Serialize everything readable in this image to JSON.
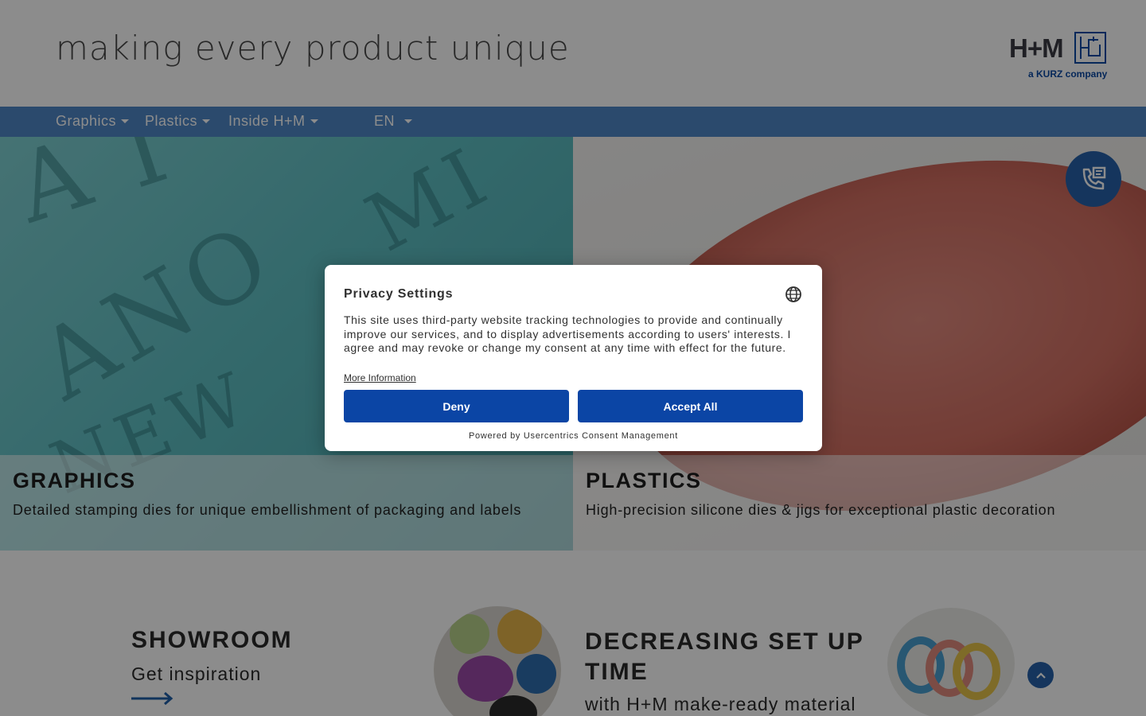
{
  "header": {
    "tagline": "making every product unique",
    "logo_text": "H+M",
    "logo_sub": "a KURZ company"
  },
  "nav": {
    "items": [
      {
        "label": "Graphics"
      },
      {
        "label": "Plastics"
      },
      {
        "label": "Inside H+M"
      }
    ],
    "language": "EN"
  },
  "tiles": {
    "graphics": {
      "title": "GRAPHICS",
      "description": "Detailed stamping dies for unique embellishment of packaging and labels"
    },
    "plastics": {
      "title": "PLASTICS",
      "description": "High-precision silicone dies & jigs for exceptional plastic decoration"
    }
  },
  "features": {
    "showroom": {
      "title": "SHOWROOM",
      "subtitle": "Get inspiration"
    },
    "setup": {
      "title": "DECREASING SET UP TIME",
      "subtitle": "with H+M make-ready material"
    }
  },
  "consent": {
    "title": "Privacy Settings",
    "body": "This site uses third-party website tracking technologies to provide and continually improve our services, and to display advertisements according to users' interests. I agree and may revoke or change my consent at any time with effect for the future.",
    "more_info": "More Information",
    "deny_label": "Deny",
    "accept_label": "Accept All",
    "powered_by": "Powered by Usercentrics Consent Management"
  },
  "colors": {
    "nav_bg": "#4f88c6",
    "brand_blue": "#0b45a5",
    "contact_blue": "#2762aa"
  },
  "icons": {
    "contact": "phone-contact-icon",
    "language": "globe-icon",
    "back_to_top": "chevron-up-icon",
    "arrow": "arrow-right-icon"
  }
}
